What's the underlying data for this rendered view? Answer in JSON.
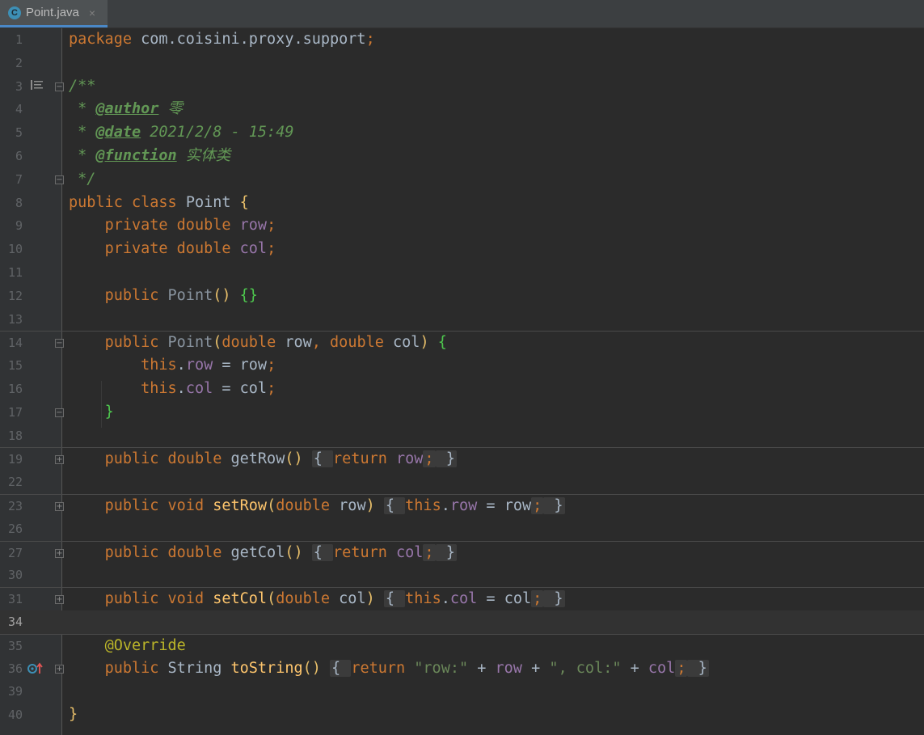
{
  "tab": {
    "filename": "Point.java",
    "icon": "C",
    "close": "×"
  },
  "lines": [
    {
      "n": "1"
    },
    {
      "n": "2"
    },
    {
      "n": "3"
    },
    {
      "n": "4"
    },
    {
      "n": "5"
    },
    {
      "n": "6"
    },
    {
      "n": "7"
    },
    {
      "n": "8"
    },
    {
      "n": "9"
    },
    {
      "n": "10"
    },
    {
      "n": "11"
    },
    {
      "n": "12"
    },
    {
      "n": "13"
    },
    {
      "n": "14"
    },
    {
      "n": "15"
    },
    {
      "n": "16"
    },
    {
      "n": "17"
    },
    {
      "n": "18"
    },
    {
      "n": "19"
    },
    {
      "n": "22"
    },
    {
      "n": "23"
    },
    {
      "n": "26"
    },
    {
      "n": "27"
    },
    {
      "n": "30"
    },
    {
      "n": "31"
    },
    {
      "n": "34"
    },
    {
      "n": "35"
    },
    {
      "n": "36"
    },
    {
      "n": "39"
    },
    {
      "n": "40"
    }
  ],
  "code": {
    "package_kw": "package",
    "package_name": " com.coisini.proxy.support",
    "semi": ";",
    "doc_open": "/**",
    "doc_star": " * ",
    "tag_author": "@author",
    "author_val": " 零",
    "tag_date": "@date",
    "date_val": " 2021/2/8 - 15:49",
    "tag_function": "@function",
    "function_val": " 实体类",
    "doc_close": " */",
    "public": "public",
    "private": "private",
    "class": "class",
    "class_name": "Point",
    "double": "double",
    "void": "void",
    "field_row": "row",
    "field_col": "col",
    "this": "this",
    "return": "return",
    "string": "String",
    "override": "@Override",
    "getRow": "getRow",
    "setRow": "setRow",
    "getCol": "getCol",
    "setCol": "setCol",
    "toString": "toString",
    "str_row": "\"row:\"",
    "str_col": "\", col:\""
  }
}
